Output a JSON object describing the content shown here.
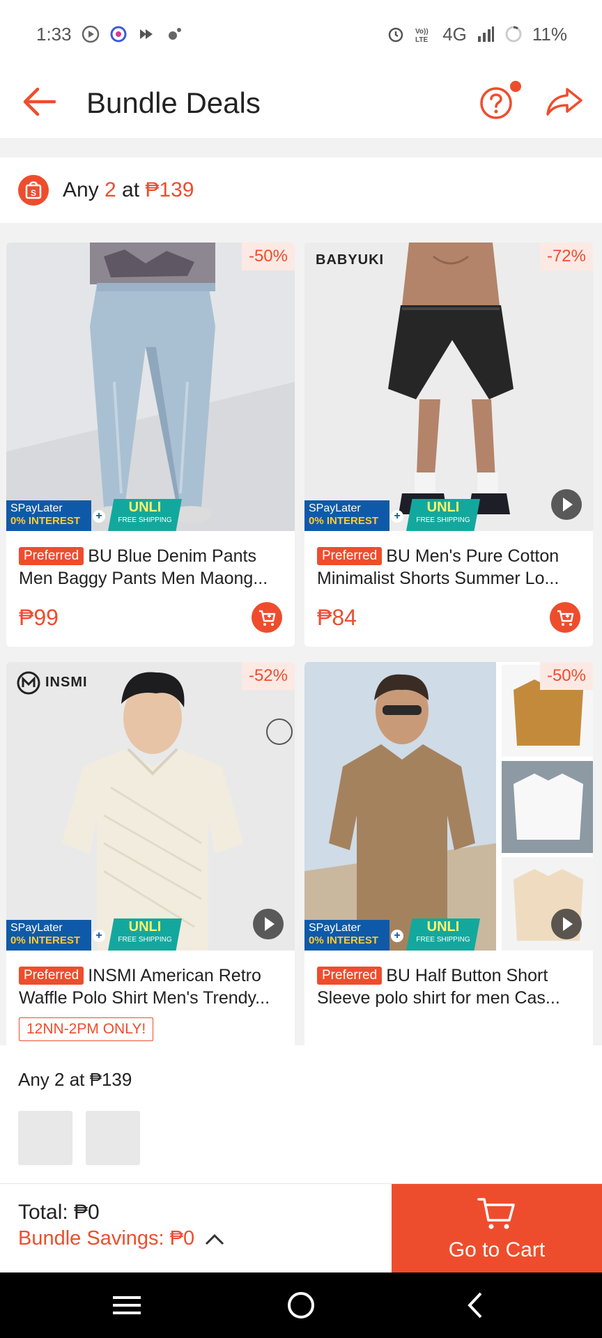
{
  "status_bar": {
    "time": "1:33",
    "network": "4G",
    "battery": "11%"
  },
  "header": {
    "title": "Bundle Deals"
  },
  "deal": {
    "prefix": "Any ",
    "quantity": "2",
    "middle": " at ",
    "price": "₱139"
  },
  "products": [
    {
      "discount": "-50%",
      "tag": "Preferred",
      "title": "BU Blue Denim Pants Men Baggy Pants Men Maong...",
      "price": "₱99",
      "brand": "",
      "has_video": false
    },
    {
      "discount": "-72%",
      "tag": "Preferred",
      "title": "BU Men's Pure Cotton Minimalist Shorts Summer Lo...",
      "price": "₱84",
      "brand": "BABYUKI",
      "has_video": true
    },
    {
      "discount": "-52%",
      "tag": "Preferred",
      "title": "INSMI American Retro Waffle Polo Shirt Men's Trendy...",
      "time_tag": "12NN-2PM ONLY!",
      "brand": "INSMI",
      "has_video": true
    },
    {
      "discount": "-50%",
      "tag": "Preferred",
      "title": "BU Half Button Short Sleeve polo shirt for men Cas...",
      "has_video": true
    }
  ],
  "promo_badge": {
    "spaylater": "SPayLater",
    "interest": "0% INTEREST",
    "unli": "UNLI",
    "free_shipping": "FREE SHIPPING"
  },
  "selection": {
    "label": "Any 2 at ₱139"
  },
  "footer": {
    "total": "Total: ₱0",
    "savings": "Bundle Savings: ₱0",
    "go_to_cart": "Go to Cart"
  },
  "colors": {
    "accent": "#ee4d2d",
    "spaylater_blue": "#0f5aa8",
    "unli_teal": "#13a89e"
  }
}
